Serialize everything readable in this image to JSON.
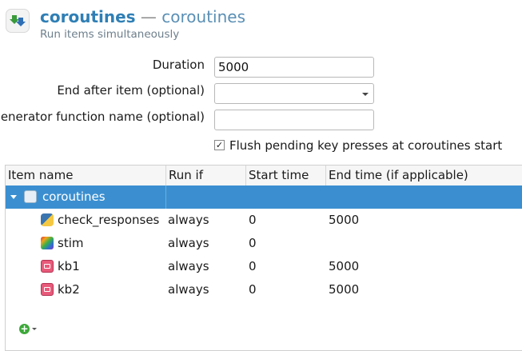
{
  "header": {
    "item_name": "coroutines",
    "separator": " — ",
    "item_type": "coroutines",
    "subtitle": "Run items simultaneously"
  },
  "form": {
    "duration_label": "Duration",
    "duration_value": "5000",
    "end_after_label": "End after item (optional)",
    "end_after_value": "",
    "generator_label": "Generator function name (optional)",
    "generator_value": "",
    "flush_label": "Flush pending key presses at coroutines start",
    "flush_checked": true
  },
  "table": {
    "columns": [
      "Item name",
      "Run if",
      "Start time",
      "End time (if applicable)"
    ],
    "root": {
      "name": "coroutines",
      "icon": "coroutines-icon",
      "expanded": true
    },
    "rows": [
      {
        "name": "check_responses",
        "icon": "python-icon",
        "run_if": "always",
        "start": "0",
        "end": "5000"
      },
      {
        "name": "stim",
        "icon": "stimulus-icon",
        "run_if": "always",
        "start": "0",
        "end": ""
      },
      {
        "name": "kb1",
        "icon": "keyboard-icon",
        "run_if": "always",
        "start": "0",
        "end": "5000"
      },
      {
        "name": "kb2",
        "icon": "keyboard-icon",
        "run_if": "always",
        "start": "0",
        "end": "5000"
      }
    ]
  },
  "colors": {
    "accent": "#2f7fb5",
    "selection": "#3b8fd0",
    "add_button": "#3da83a"
  }
}
